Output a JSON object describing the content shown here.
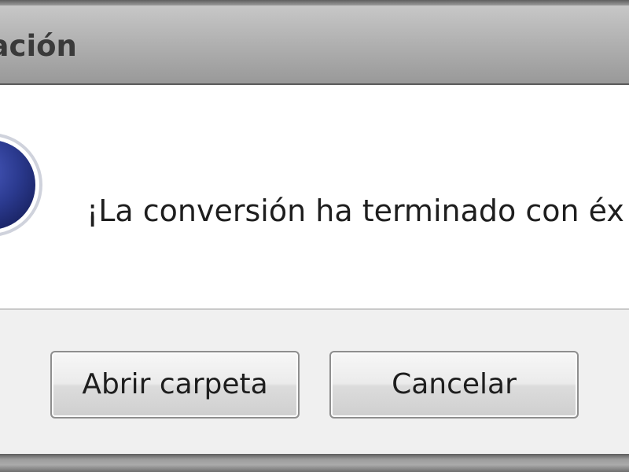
{
  "dialog": {
    "title": "mación",
    "message": "¡La conversión ha terminado con éx",
    "icon": "info-icon"
  },
  "buttons": {
    "open_folder_label": "Abrir carpeta",
    "cancel_label": "Cancelar"
  },
  "colors": {
    "icon_blue": "#2b3a8f",
    "content_background": "#ffffff",
    "button_area_background": "#f0f0f0"
  }
}
